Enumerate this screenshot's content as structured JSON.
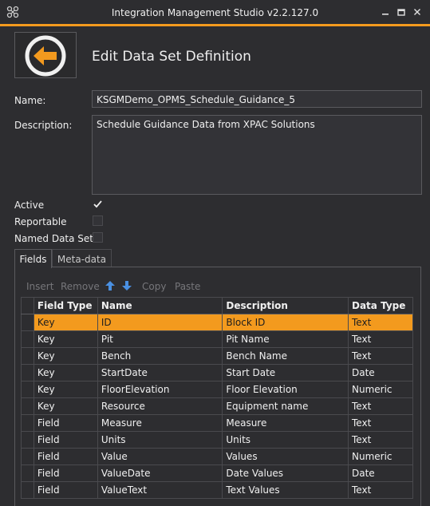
{
  "window": {
    "title": "Integration Management Studio v2.2.127.0",
    "accent_color": "#f39a1e"
  },
  "header": {
    "title": "Edit Data Set Definition",
    "back_icon": "back-arrow-icon"
  },
  "form": {
    "name_label": "Name:",
    "name_value": "KSGMDemo_OPMS_Schedule_Guidance_5",
    "description_label": "Description:",
    "description_value": "Schedule Guidance Data from XPAC Solutions",
    "active_label": "Active",
    "active_checked": true,
    "reportable_label": "Reportable",
    "reportable_checked": false,
    "named_data_sets_label": "Named Data Sets",
    "named_data_sets_checked": false
  },
  "tabs": [
    {
      "label": "Fields",
      "active": true
    },
    {
      "label": "Meta-data",
      "active": false
    }
  ],
  "toolbar": {
    "insert": "Insert",
    "remove": "Remove",
    "move_up_icon": "arrow-up-icon",
    "move_down_icon": "arrow-down-icon",
    "copy": "Copy",
    "paste": "Paste"
  },
  "grid": {
    "columns": [
      "Field Type",
      "Name",
      "Description",
      "Data Type"
    ],
    "rows": [
      {
        "field_type": "Key",
        "name": "ID",
        "description": "Block ID",
        "data_type": "Text",
        "selected": true
      },
      {
        "field_type": "Key",
        "name": "Pit",
        "description": "Pit Name",
        "data_type": "Text"
      },
      {
        "field_type": "Key",
        "name": "Bench",
        "description": "Bench Name",
        "data_type": "Text"
      },
      {
        "field_type": "Key",
        "name": "StartDate",
        "description": "Start Date",
        "data_type": "Date"
      },
      {
        "field_type": "Key",
        "name": "FloorElevation",
        "description": "Floor Elevation",
        "data_type": "Numeric"
      },
      {
        "field_type": "Key",
        "name": "Resource",
        "description": "Equipment name",
        "data_type": "Text"
      },
      {
        "field_type": "Field",
        "name": "Measure",
        "description": "Measure",
        "data_type": "Text"
      },
      {
        "field_type": "Field",
        "name": "Units",
        "description": "Units",
        "data_type": "Text"
      },
      {
        "field_type": "Field",
        "name": "Value",
        "description": "Values",
        "data_type": "Numeric"
      },
      {
        "field_type": "Field",
        "name": "ValueDate",
        "description": "Date Values",
        "data_type": "Date"
      },
      {
        "field_type": "Field",
        "name": "ValueText",
        "description": "Text Values",
        "data_type": "Text"
      }
    ]
  }
}
